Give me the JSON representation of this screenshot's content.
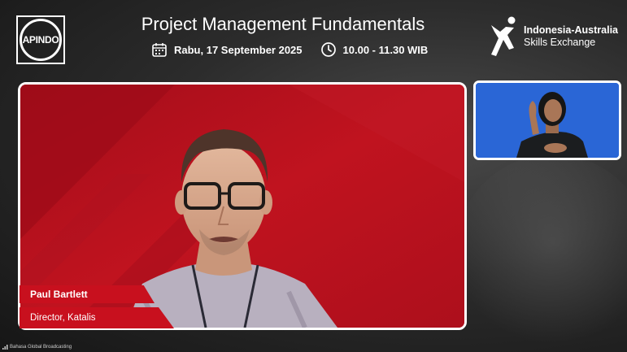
{
  "header": {
    "title": "Project Management Fundamentals",
    "date": "Rabu, 17 September 2025",
    "time": "10.00 - 11.30 WIB"
  },
  "logos": {
    "left": "APINDO",
    "right_line1": "Indonesia-Australia",
    "right_line2": "Skills Exchange"
  },
  "speaker": {
    "name": "Paul Bartlett",
    "role": "Director, Katalis"
  },
  "footer": {
    "label": "Bahasa Global Broadcasting"
  },
  "colors": {
    "red_bg": "#b3111f",
    "tag_red": "#c8101e",
    "sign_bg": "#2a66d6"
  },
  "icons": [
    "calendar-icon",
    "clock-icon",
    "signal-icon"
  ]
}
